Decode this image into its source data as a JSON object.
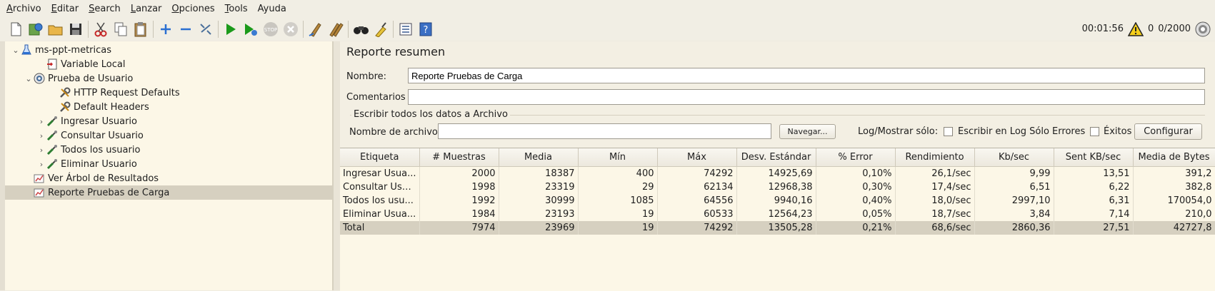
{
  "menu": [
    {
      "pre": "",
      "mn": "A",
      "post": "rchivo"
    },
    {
      "pre": "",
      "mn": "E",
      "post": "ditar"
    },
    {
      "pre": "",
      "mn": "S",
      "post": "earch"
    },
    {
      "pre": "",
      "mn": "L",
      "post": "anzar"
    },
    {
      "pre": "",
      "mn": "O",
      "post": "pciones"
    },
    {
      "pre": "",
      "mn": "T",
      "post": "ools"
    },
    {
      "pre": "A",
      "mn": "",
      "post": "yuda"
    }
  ],
  "toolbar": {
    "timer": "00:01:56",
    "warnings": "0",
    "threads": "0/2000"
  },
  "tree": [
    {
      "label": "ms-ppt-metricas",
      "icon": "flask-icon",
      "twisty": "down"
    },
    {
      "label": "Variable Local",
      "icon": "config-element-icon",
      "twisty": ""
    },
    {
      "label": "Prueba de Usuario",
      "icon": "thread-group-icon",
      "twisty": "down"
    },
    {
      "label": "HTTP Request Defaults",
      "icon": "wrench-icon",
      "twisty": ""
    },
    {
      "label": "Default Headers",
      "icon": "wrench-icon",
      "twisty": ""
    },
    {
      "label": "Ingresar Usuario",
      "icon": "pipette-icon",
      "twisty": "right"
    },
    {
      "label": "Consultar Usuario",
      "icon": "pipette-icon",
      "twisty": "right"
    },
    {
      "label": "Todos los usuario",
      "icon": "pipette-icon",
      "twisty": "right"
    },
    {
      "label": "Eliminar Usuario",
      "icon": "pipette-icon",
      "twisty": "right"
    },
    {
      "label": "Ver Árbol de Resultados",
      "icon": "listener-icon",
      "twisty": ""
    },
    {
      "label": "Reporte Pruebas de Carga",
      "icon": "listener-icon",
      "twisty": ""
    }
  ],
  "panel": {
    "title": "Reporte resumen",
    "name_label": "Nombre:",
    "name_value": "Reporte Pruebas de Carga",
    "comments_label": "Comentarios",
    "comments_value": "",
    "file_section_title": "Escribir todos los datos a Archivo",
    "filename_label": "Nombre de archivo",
    "filename_value": "",
    "browse_button": "Navegar...",
    "log_show_label": "Log/Mostrar sólo:",
    "errors_only_label": "Escribir en Log Sólo Errores",
    "success_label": "Éxitos",
    "configure_button": "Configurar"
  },
  "table": {
    "headers": [
      "Etiqueta",
      "# Muestras",
      "Media",
      "Mín",
      "Máx",
      "Desv. Estándar",
      "% Error",
      "Rendimiento",
      "Kb/sec",
      "Sent KB/sec",
      "Media de Bytes"
    ],
    "rows": [
      [
        "Ingresar Usua...",
        "2000",
        "18387",
        "400",
        "74292",
        "14925,69",
        "0,10%",
        "26,1/sec",
        "9,99",
        "13,51",
        "391,2"
      ],
      [
        "Consultar Usu...",
        "1998",
        "23319",
        "29",
        "62134",
        "12968,38",
        "0,30%",
        "17,4/sec",
        "6,51",
        "6,22",
        "382,8"
      ],
      [
        "Todos los usu...",
        "1992",
        "30999",
        "1085",
        "64556",
        "9940,16",
        "0,40%",
        "18,0/sec",
        "2997,10",
        "6,31",
        "170054,0"
      ],
      [
        "Eliminar Usua...",
        "1984",
        "23193",
        "19",
        "60533",
        "12564,23",
        "0,05%",
        "18,7/sec",
        "3,84",
        "7,14",
        "210,0"
      ],
      [
        "Total",
        "7974",
        "23969",
        "19",
        "74292",
        "13505,28",
        "0,21%",
        "68,6/sec",
        "2860,36",
        "27,51",
        "42727,8"
      ]
    ]
  }
}
